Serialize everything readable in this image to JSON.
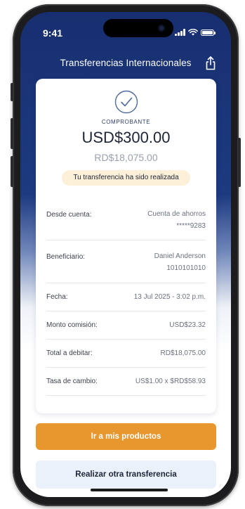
{
  "status_bar": {
    "time": "9:41"
  },
  "header": {
    "title": "Transferencias Internacionales",
    "share_icon": "share-icon"
  },
  "receipt": {
    "icon": "check-circle-icon",
    "label": "COMPROBANTE",
    "amount_usd": "USD$300.00",
    "amount_local": "RD$18,075.00",
    "status_message": "Tu transferencia ha sido realizada",
    "rows": [
      {
        "label": "Desde cuenta:",
        "value_line1": "Cuenta de ahorros",
        "value_line2": "*****9283"
      },
      {
        "label": "Beneficiario:",
        "value_line1": "Daniel Anderson",
        "value_line2": "1010101010"
      },
      {
        "label": "Fecha:",
        "value_line1": "13 Jul 2025 - 3:02 p.m."
      },
      {
        "label": "Monto comisión:",
        "value_line1": "USD$23.32"
      },
      {
        "label": "Total a debitar:",
        "value_line1": "RD$18,075.00"
      },
      {
        "label": "Tasa de cambio:",
        "value_line1": "US$1.00 x $RD$58.93"
      }
    ]
  },
  "actions": {
    "primary_label": "Ir a mis productos",
    "secondary_label": "Realizar otra transferencia"
  },
  "colors": {
    "header_navy": "#172f70",
    "accent_orange": "#e8962e",
    "badge_cream": "#fdf0d9",
    "secondary_blue_tint": "#eaf1fb"
  }
}
